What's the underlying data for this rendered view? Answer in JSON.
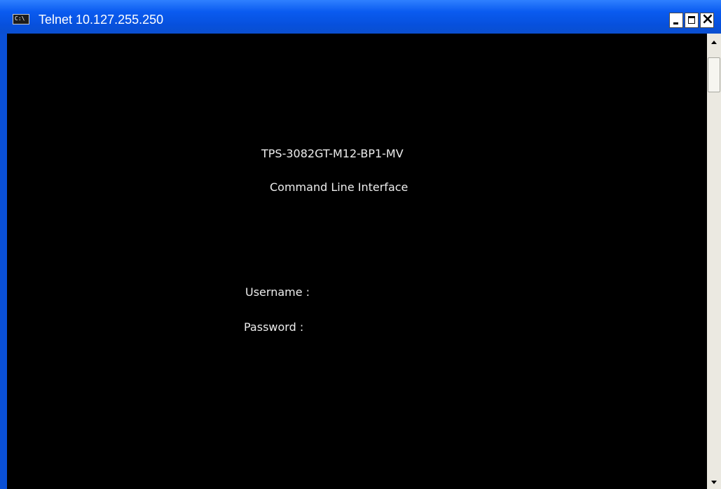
{
  "window": {
    "title": "Telnet 10.127.255.250",
    "icon": "console-icon",
    "icon_text": "C:\\",
    "controls": [
      "minimize-icon",
      "maximize-icon",
      "close-icon"
    ]
  },
  "console": {
    "model": "TPS-3082GT-M12-BP1-MV",
    "subtitle": "Command Line Interface",
    "username_prompt": "Username :",
    "password_prompt": "Password :"
  },
  "colors": {
    "titlebar": "#0a5bf0",
    "console_bg": "#000000",
    "console_text": "#ededed",
    "scrollbar": "#ebe9e1"
  }
}
